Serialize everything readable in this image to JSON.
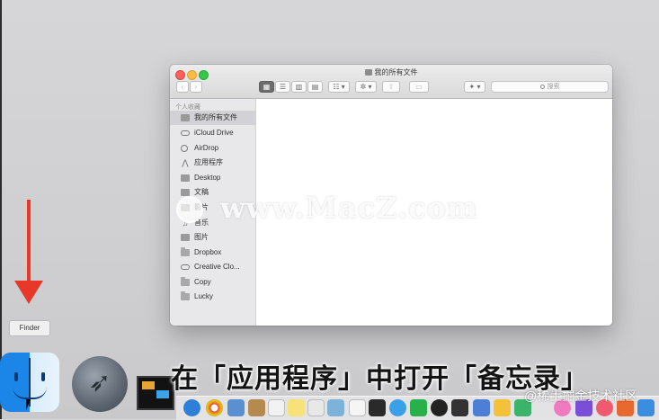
{
  "window": {
    "title": "我的所有文件",
    "search_placeholder": "搜索",
    "toolbar": {
      "back": "‹",
      "forward": "›",
      "icon_view": "▦",
      "list_view": "☰",
      "column_view": "▥",
      "cover_flow_view": "▤",
      "arrange": "☷ ▾",
      "action": "✲ ▾",
      "share": "⇧",
      "tags": "▭",
      "dropbox": "✦ ▾"
    }
  },
  "sidebar": {
    "heading": "个人收藏",
    "items": [
      {
        "label": "我的所有文件",
        "icon": "all-files-icon"
      },
      {
        "label": "iCloud Drive",
        "icon": "cloud-icon"
      },
      {
        "label": "AirDrop",
        "icon": "airdrop-icon"
      },
      {
        "label": "应用程序",
        "icon": "applications-icon"
      },
      {
        "label": "Desktop",
        "icon": "desktop-icon"
      },
      {
        "label": "文稿",
        "icon": "documents-icon"
      },
      {
        "label": "影片",
        "icon": "movies-icon"
      },
      {
        "label": "音乐",
        "icon": "music-icon"
      },
      {
        "label": "图片",
        "icon": "pictures-icon"
      },
      {
        "label": "Dropbox",
        "icon": "folder-icon"
      },
      {
        "label": "Creative Clo...",
        "icon": "creative-cloud-icon"
      },
      {
        "label": "Copy",
        "icon": "folder-icon"
      },
      {
        "label": "Lucky",
        "icon": "folder-icon"
      }
    ]
  },
  "overlay": {
    "watermark": "www.MacZ.com",
    "subtitle": "在「应用程序」中打开「备忘录」",
    "tooltip": "Finder",
    "dock_watermark": "@稀土掘金技术社区"
  },
  "colors": {
    "arrow": "#e8382a",
    "selection": "#d2d2d6",
    "sidebar_bg": "#e8e8ea"
  }
}
